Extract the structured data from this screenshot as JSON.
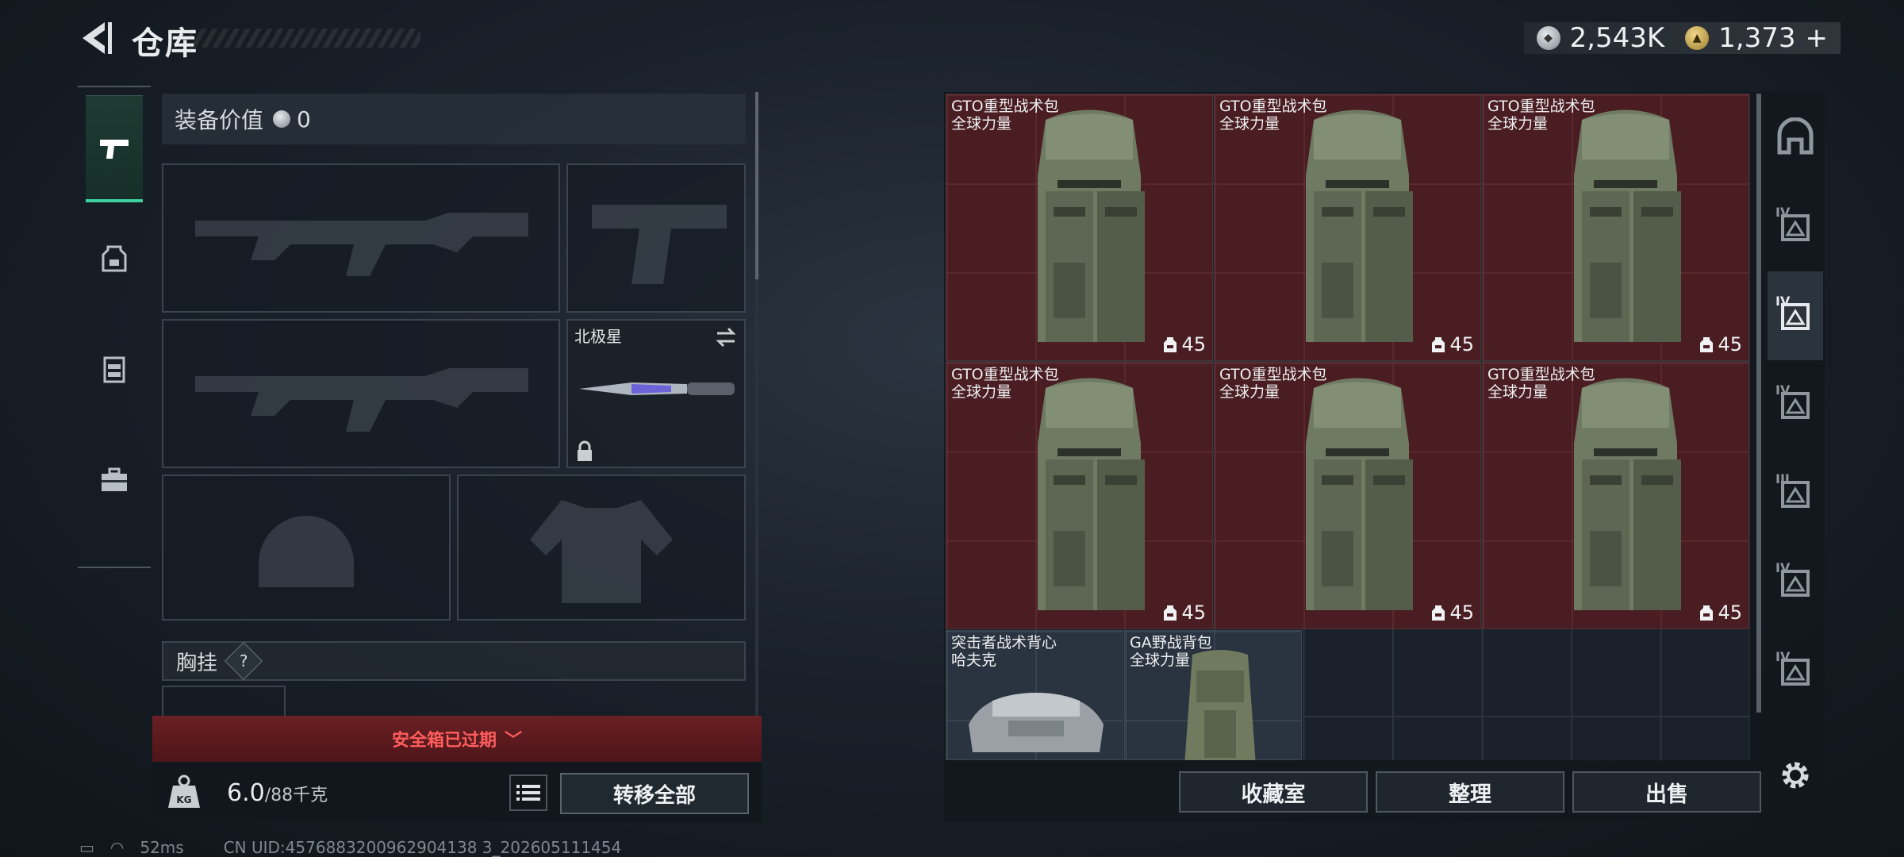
{
  "header": {
    "title": "仓库"
  },
  "currency": {
    "silver": "2,543K",
    "gold": "1,373",
    "add": "+"
  },
  "equipment": {
    "value_label": "装备价值",
    "value": "0",
    "melee_name": "北极星",
    "chest_rig_label": "胸挂",
    "help": "?"
  },
  "safebox": {
    "status": "安全箱已过期"
  },
  "weight": {
    "current": "6.0",
    "max": "/88千克"
  },
  "left_actions": {
    "transfer_all": "转移全部"
  },
  "storage": {
    "items": [
      {
        "name": "GTO重型战术包",
        "sub": "全球力量",
        "capacity": "45"
      },
      {
        "name": "GTO重型战术包",
        "sub": "全球力量",
        "capacity": "45"
      },
      {
        "name": "GTO重型战术包",
        "sub": "全球力量",
        "capacity": "45"
      },
      {
        "name": "GTO重型战术包",
        "sub": "全球力量",
        "capacity": "45"
      },
      {
        "name": "GTO重型战术包",
        "sub": "全球力量",
        "capacity": "45"
      },
      {
        "name": "GTO重型战术包",
        "sub": "全球力量",
        "capacity": "45"
      },
      {
        "name": "突击者战术背心",
        "sub": "哈夫克"
      },
      {
        "name": "GA野战背包",
        "sub": "全球力量"
      }
    ]
  },
  "categories": [
    {
      "icon": "home-icon",
      "level": ""
    },
    {
      "icon": "armor-level-icon",
      "level": "IV"
    },
    {
      "icon": "backpack-level-icon",
      "level": "IV"
    },
    {
      "icon": "rig-level-icon",
      "level": "IV"
    },
    {
      "icon": "rifle-level-icon",
      "level": "III"
    },
    {
      "icon": "pistol-level-icon",
      "level": "IV"
    },
    {
      "icon": "helmet-level-icon",
      "level": "IV"
    }
  ],
  "right_actions": {
    "collection": "收藏室",
    "sort": "整理",
    "sell": "出售"
  },
  "status": {
    "ping": "52ms",
    "uid": "CN UID:4576883200962904138 3_202605111454"
  },
  "colors": {
    "accent": "#3fd1a2",
    "item_red": "#4a1d22",
    "warning": "#ff5d5d"
  }
}
